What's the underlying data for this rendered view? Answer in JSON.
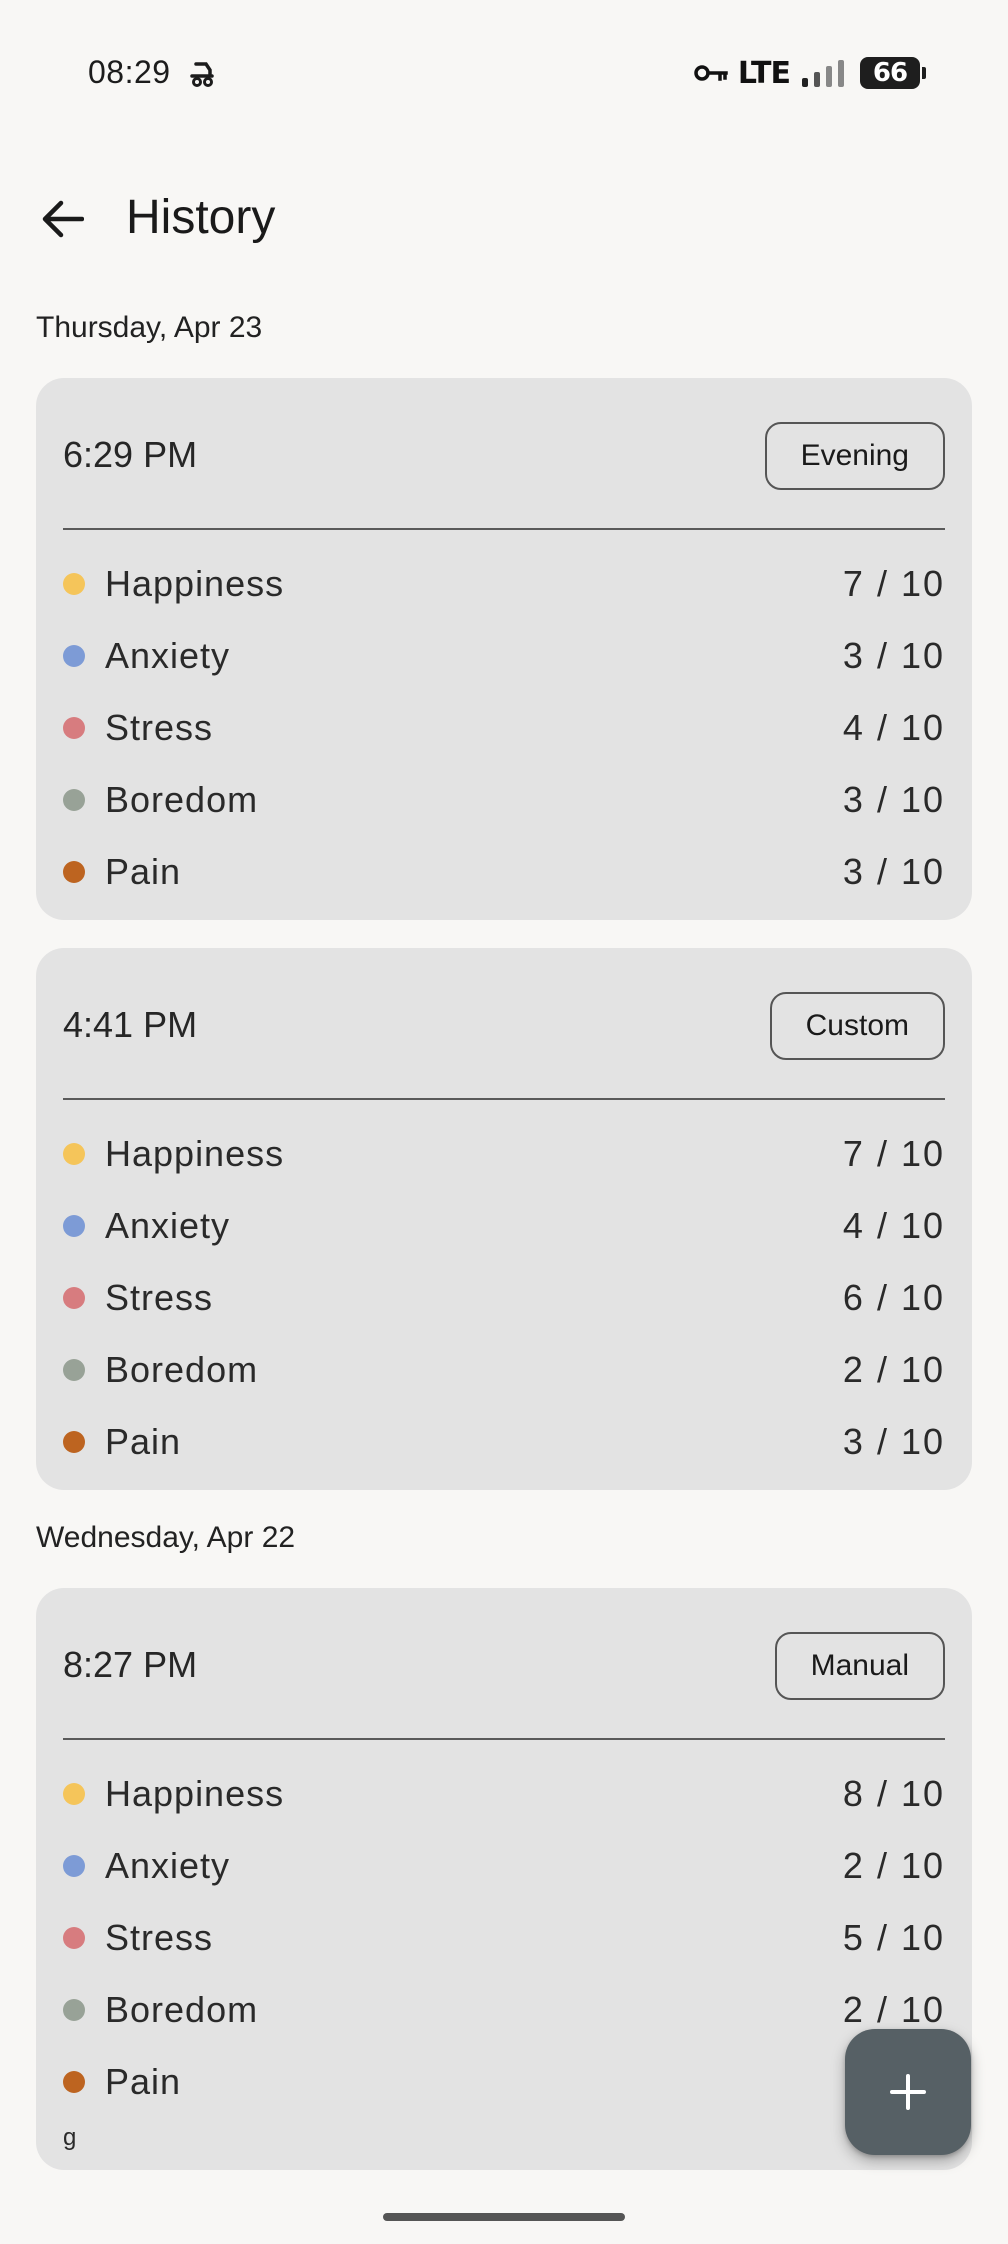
{
  "status_bar": {
    "time": "08:29",
    "network": "LTE",
    "battery": "66"
  },
  "app_bar": {
    "title": "History",
    "back_icon": "arrow-left-icon"
  },
  "days": [
    {
      "label": "Thursday, Apr 23",
      "entries": [
        {
          "time": "6:29 PM",
          "type": "Evening",
          "metrics": [
            {
              "name": "Happiness",
              "value": "7 / 10",
              "color": "#f5c55a"
            },
            {
              "name": "Anxiety",
              "value": "3 / 10",
              "color": "#7d9bd6"
            },
            {
              "name": "Stress",
              "value": "4 / 10",
              "color": "#d77c7f"
            },
            {
              "name": "Boredom",
              "value": "3 / 10",
              "color": "#98a297"
            },
            {
              "name": "Pain",
              "value": "3 / 10",
              "color": "#bd6420"
            }
          ],
          "note": ""
        },
        {
          "time": "4:41 PM",
          "type": "Custom",
          "metrics": [
            {
              "name": "Happiness",
              "value": "7 / 10",
              "color": "#f5c55a"
            },
            {
              "name": "Anxiety",
              "value": "4 / 10",
              "color": "#7d9bd6"
            },
            {
              "name": "Stress",
              "value": "6 / 10",
              "color": "#d77c7f"
            },
            {
              "name": "Boredom",
              "value": "2 / 10",
              "color": "#98a297"
            },
            {
              "name": "Pain",
              "value": "3 / 10",
              "color": "#bd6420"
            }
          ],
          "note": ""
        }
      ]
    },
    {
      "label": "Wednesday, Apr 22",
      "entries": [
        {
          "time": "8:27 PM",
          "type": "Manual",
          "metrics": [
            {
              "name": "Happiness",
              "value": "8 / 10",
              "color": "#f5c55a"
            },
            {
              "name": "Anxiety",
              "value": "2 / 10",
              "color": "#7d9bd6"
            },
            {
              "name": "Stress",
              "value": "5 / 10",
              "color": "#d77c7f"
            },
            {
              "name": "Boredom",
              "value": "2 / 10",
              "color": "#98a297"
            },
            {
              "name": "Pain",
              "value": "",
              "color": "#bd6420"
            }
          ],
          "note": "g"
        }
      ]
    }
  ],
  "fab": {
    "icon": "plus-icon"
  },
  "colors": {
    "background": "#f8f7f5",
    "card": "#e3e3e3",
    "fab": "#566065"
  }
}
